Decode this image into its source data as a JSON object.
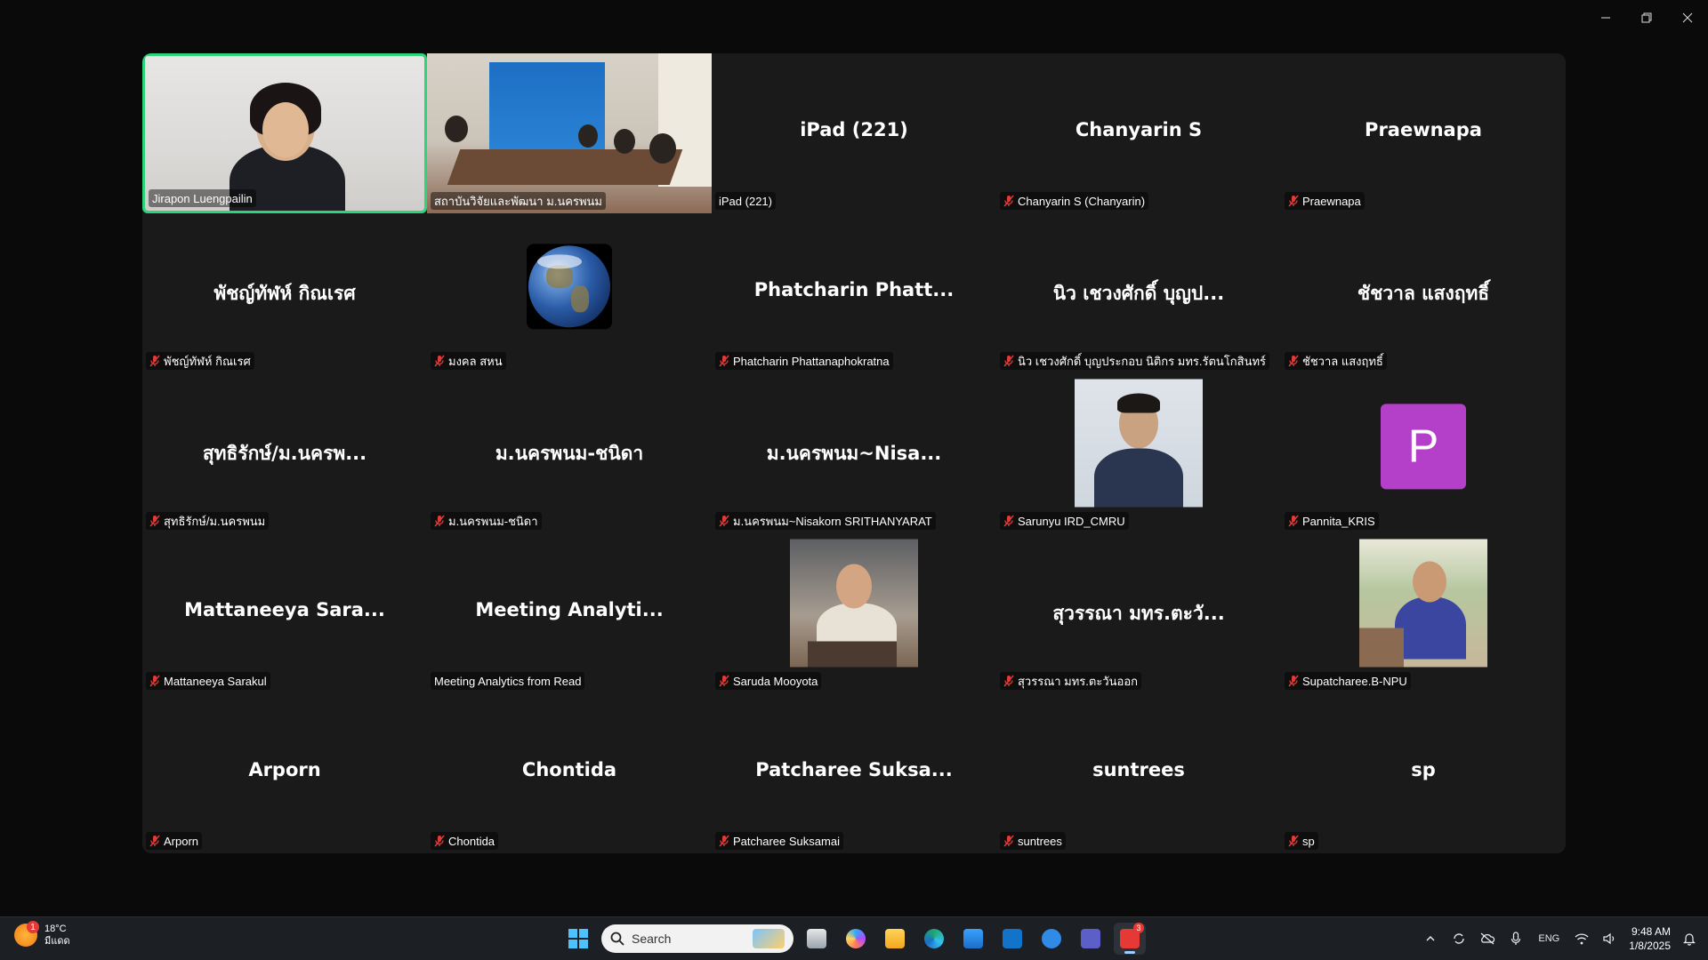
{
  "tiles": [
    {
      "label": "Jirapon Luengpailin",
      "big": "",
      "kind": "video-person",
      "muted": false
    },
    {
      "label": "สถาบันวิจัยและพัฒนา ม.นครพนม",
      "big": "",
      "kind": "video-room",
      "muted": false
    },
    {
      "label": "iPad (221)",
      "big": "iPad (221)",
      "kind": "name",
      "muted": false
    },
    {
      "label": "Chanyarin S (Chanyarin)",
      "big": "Chanyarin S",
      "kind": "name",
      "muted": true
    },
    {
      "label": "Praewnapa",
      "big": "Praewnapa",
      "kind": "name",
      "muted": true
    },
    {
      "label": "พัชญ์ทัฬห์ กิณเรศ",
      "big": "พัชญ์ทัฬห์ กิณเรศ",
      "kind": "name",
      "muted": true
    },
    {
      "label": "มงคล สหน",
      "big": "",
      "kind": "globe",
      "muted": true
    },
    {
      "label": "Phatcharin Phattanaphokratna",
      "big": "Phatcharin Phatt...",
      "kind": "name",
      "muted": true
    },
    {
      "label": "นิว เชวงศักดิ์ บุญประกอบ นิติกร มทร.รัตนโกสินทร์",
      "big": "นิว เชวงศักดิ์ บุญป...",
      "kind": "name",
      "muted": true
    },
    {
      "label": "ชัชวาล แสงฤทธิ์",
      "big": "ชัชวาล แสงฤทธิ์",
      "kind": "name",
      "muted": true
    },
    {
      "label": "สุทธิรักษ์/ม.นครพนม",
      "big": "สุทธิรักษ์/ม.นครพ...",
      "kind": "name",
      "muted": true
    },
    {
      "label": "ม.นครพนม-ชนิดา",
      "big": "ม.นครพนม-ชนิดา",
      "kind": "name",
      "muted": true
    },
    {
      "label": "ม.นครพนม~Nisakorn SRITHANYARAT",
      "big": "ม.นครพนม~Nisa...",
      "kind": "name",
      "muted": true
    },
    {
      "label": "Sarunyu IRD_CMRU",
      "big": "",
      "kind": "photo-sarunyu",
      "muted": true
    },
    {
      "label": "Pannita_KRIS",
      "big": "",
      "kind": "avatar-p",
      "muted": true
    },
    {
      "label": "Mattaneeya Sarakul",
      "big": "Mattaneeya Sara...",
      "kind": "name",
      "muted": true
    },
    {
      "label": "Meeting Analytics from Read",
      "big": "Meeting Analyti...",
      "kind": "name",
      "muted": false
    },
    {
      "label": "Saruda Mooyota",
      "big": "",
      "kind": "photo-saruda",
      "muted": true
    },
    {
      "label": "สุวรรณา มทร.ตะวันออก",
      "big": "สุวรรณา มทร.ตะวั...",
      "kind": "name",
      "muted": true
    },
    {
      "label": "Supatcharee.B-NPU",
      "big": "",
      "kind": "photo-supat",
      "muted": true
    },
    {
      "label": "Arporn",
      "big": "Arporn",
      "kind": "name",
      "muted": true
    },
    {
      "label": "Chontida",
      "big": "Chontida",
      "kind": "name",
      "muted": true
    },
    {
      "label": "Patcharee Suksamai",
      "big": "Patcharee Suksa...",
      "kind": "name",
      "muted": true
    },
    {
      "label": "suntrees",
      "big": "suntrees",
      "kind": "name",
      "muted": true
    },
    {
      "label": "sp",
      "big": "sp",
      "kind": "name",
      "muted": true
    }
  ],
  "avatar_letter": "P",
  "taskbar": {
    "weather": {
      "temp": "18°C",
      "condition": "มีแดด",
      "badge": "1"
    },
    "search_placeholder": "Search",
    "zoom_badge": "3",
    "language": "ENG",
    "time": "9:48 AM",
    "date": "1/8/2025"
  },
  "colors": {
    "active_border": "#2bd67b",
    "mute_red": "#e53935",
    "avatar_purple": "#b43fc8"
  }
}
